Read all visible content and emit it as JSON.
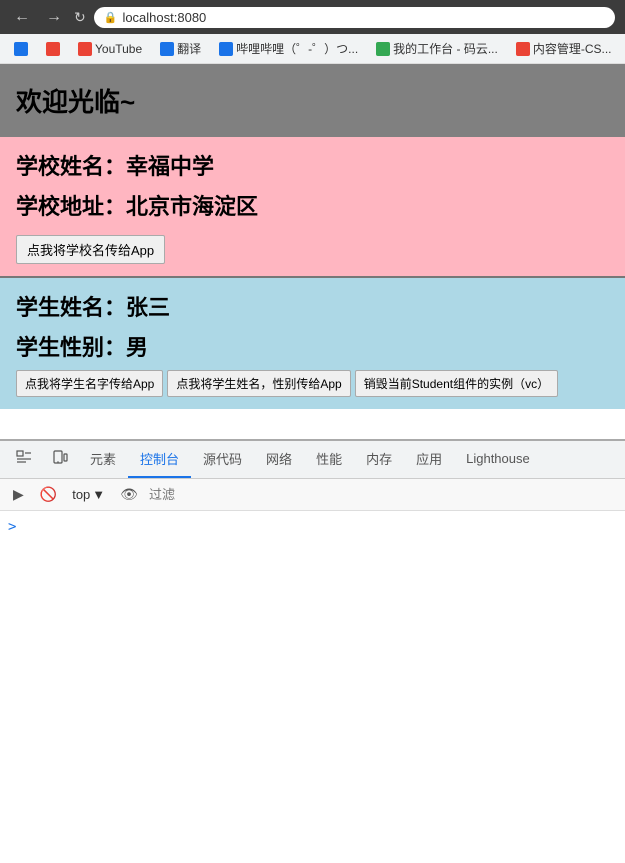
{
  "browser": {
    "url": "localhost:8080",
    "back_label": "←",
    "forward_label": "→",
    "refresh_label": "↻"
  },
  "bookmarks": [
    {
      "id": "bk1",
      "label": "",
      "color": "bk-blue",
      "icon_name": "bookmark-icon-1"
    },
    {
      "id": "bk2",
      "label": "",
      "color": "bk-red",
      "icon_name": "bookmark-icon-2"
    },
    {
      "id": "bk3",
      "label": "YouTube",
      "color": "bk-red",
      "icon_name": "youtube-icon"
    },
    {
      "id": "bk4",
      "label": "翻译",
      "color": "bk-blue",
      "icon_name": "translate-icon"
    },
    {
      "id": "bk5",
      "label": "哔哩哔哩（゜-゜）つ...",
      "color": "bk-blue",
      "icon_name": "bilibili-icon"
    },
    {
      "id": "bk6",
      "label": "我的工作台 - 码云...",
      "color": "bk-green",
      "icon_name": "gitee-icon"
    },
    {
      "id": "bk7",
      "label": "内容管理-CS...",
      "color": "bk-red",
      "icon_name": "cms-icon"
    }
  ],
  "page": {
    "welcome": "欢迎光临~",
    "school": {
      "name_label": "学校姓名：幸福中学",
      "address_label": "学校地址：北京市海淀区",
      "btn_label": "点我将学校名传给App"
    },
    "student": {
      "name_label": "学生姓名：张三",
      "gender_label": "学生性别：男",
      "btn1_label": "点我将学生名字传给App",
      "btn2_label": "点我将学生姓名，性别传给App",
      "btn3_label": "销毁当前Student组件的实例（vc）"
    }
  },
  "devtools": {
    "tabs": [
      {
        "id": "elements",
        "label": "元素"
      },
      {
        "id": "console",
        "label": "控制台"
      },
      {
        "id": "sources",
        "label": "源代码"
      },
      {
        "id": "network",
        "label": "网络"
      },
      {
        "id": "performance",
        "label": "性能"
      },
      {
        "id": "memory",
        "label": "内存"
      },
      {
        "id": "application",
        "label": "应用"
      },
      {
        "id": "lighthouse",
        "label": "Lighthouse"
      }
    ],
    "active_tab": "console",
    "toolbar": {
      "top_label": "top",
      "dropdown_arrow": "▼",
      "filter_placeholder": "过滤"
    },
    "console_prompt": ">"
  }
}
